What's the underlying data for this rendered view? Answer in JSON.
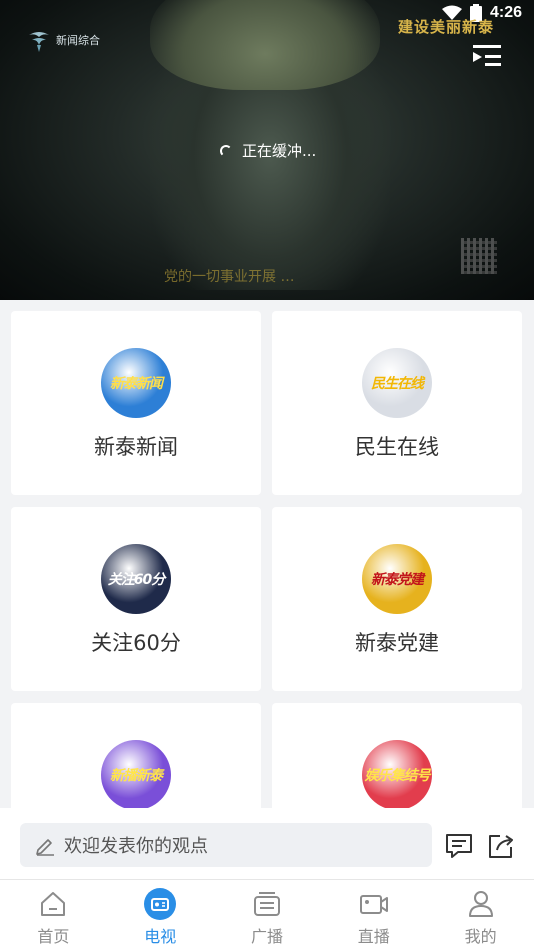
{
  "status_bar": {
    "time": "4:26"
  },
  "video": {
    "channel_logo_text": "新闻综合",
    "watermark": "建设美丽新泰",
    "buffering_text": "正在缓冲...",
    "subtitle": "党的一切事业开展 …",
    "playlist_icon": "playlist-icon"
  },
  "programs": [
    {
      "label": "新泰新闻",
      "thumb_text": "新泰新闻",
      "thumb_bg": "#2d7fd6",
      "thumb_fg": "#ffdf4a"
    },
    {
      "label": "民生在线",
      "thumb_text": "民生在线",
      "thumb_bg": "#d9dde4",
      "thumb_fg": "#f2b705"
    },
    {
      "label": "关注60分",
      "thumb_text": "关注60分",
      "thumb_bg": "#1f2a4a",
      "thumb_fg": "#ffffff"
    },
    {
      "label": "新泰党建",
      "thumb_text": "新泰党建",
      "thumb_bg": "#e6b21e",
      "thumb_fg": "#c2151b"
    },
    {
      "label": "",
      "thumb_text": "新播新泰",
      "thumb_bg": "#7a4fd8",
      "thumb_fg": "#ffe54a"
    },
    {
      "label": "",
      "thumb_text": "娱乐集结号",
      "thumb_bg": "#e23d4d",
      "thumb_fg": "#ffe54a"
    }
  ],
  "comment_bar": {
    "placeholder": "欢迎发表你的观点",
    "edit_icon": "pencil-icon",
    "comment_icon": "comment-icon",
    "share_icon": "share-icon"
  },
  "tabbar": {
    "tabs": [
      {
        "label": "首页",
        "icon": "home-icon",
        "active": false
      },
      {
        "label": "电视",
        "icon": "tv-icon",
        "active": true
      },
      {
        "label": "广播",
        "icon": "radio-icon",
        "active": false
      },
      {
        "label": "直播",
        "icon": "video-camera-icon",
        "active": false
      },
      {
        "label": "我的",
        "icon": "user-icon",
        "active": false
      }
    ]
  },
  "colors": {
    "accent": "#2a8ee6",
    "background": "#f2f3f5"
  }
}
